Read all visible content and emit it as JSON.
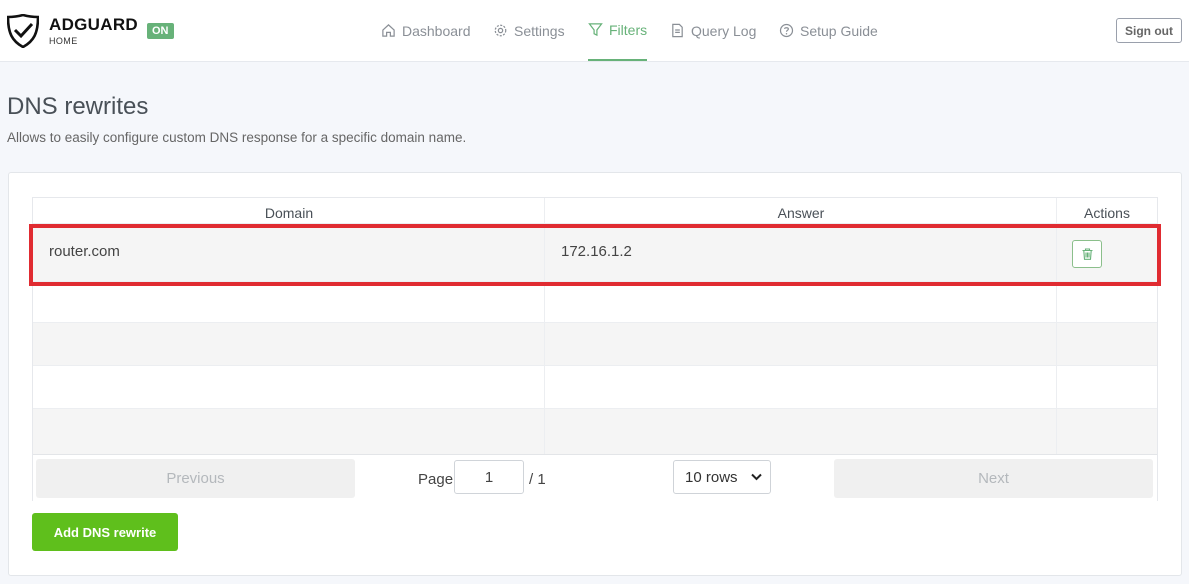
{
  "header": {
    "brand": "ADGUARD",
    "brand_sub": "HOME",
    "status_badge": "ON",
    "nav": [
      {
        "label": "Dashboard",
        "icon": "home-icon"
      },
      {
        "label": "Settings",
        "icon": "gear-icon"
      },
      {
        "label": "Filters",
        "icon": "filter-icon",
        "active": true
      },
      {
        "label": "Query Log",
        "icon": "document-icon"
      },
      {
        "label": "Setup Guide",
        "icon": "help-circle-icon"
      }
    ],
    "sign_out": "Sign out"
  },
  "page": {
    "title": "DNS rewrites",
    "subtitle": "Allows to easily configure custom DNS response for a specific domain name."
  },
  "table": {
    "columns": [
      "Domain",
      "Answer",
      "Actions"
    ],
    "rows": [
      {
        "domain": "router.com",
        "answer": "172.16.1.2",
        "action_icon": "trash-icon"
      }
    ]
  },
  "pagination": {
    "previous": "Previous",
    "page_label": "Page",
    "page_value": "1",
    "page_total": "/ 1",
    "rows_option": "10 rows",
    "next": "Next"
  },
  "add_button": "Add DNS rewrite",
  "colors": {
    "accent": "#67b279",
    "add_button": "#5fbf1c",
    "highlight": "#e02b31"
  }
}
